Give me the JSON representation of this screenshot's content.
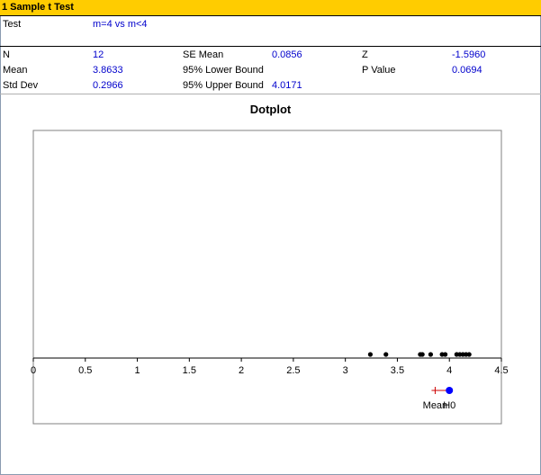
{
  "window": {
    "title": "1 Sample t Test"
  },
  "test": {
    "label": "Test",
    "value": "m=4 vs m<4"
  },
  "stats": {
    "n_label": "N",
    "n_value": "12",
    "mean_label": "Mean",
    "mean_value": "3.8633",
    "sd_label": "Std Dev",
    "sd_value": "0.2966",
    "se_label": "SE Mean",
    "se_value": "0.0856",
    "lower_label": "95% Lower Bound",
    "lower_value": "",
    "upper_label": "95% Upper Bound",
    "upper_value": "4.0171",
    "z_label": "Z",
    "z_value": "-1.5960",
    "p_label": "P Value",
    "p_value": "0.0694"
  },
  "chart_data": {
    "type": "scatter",
    "title": "Dotplot",
    "xlim": [
      0,
      4.5
    ],
    "x_ticks": [
      0,
      0.5,
      1,
      1.5,
      2,
      2.5,
      3,
      3.5,
      4,
      4.5
    ],
    "x_tick_labels": [
      "0",
      "0.5",
      "1",
      "1.5",
      "2",
      "2.5",
      "3",
      "3.5",
      "4",
      "4.5"
    ],
    "points": [
      3.24,
      3.39,
      3.72,
      3.74,
      3.82,
      3.93,
      3.96,
      4.07,
      4.1,
      4.13,
      4.16,
      4.19
    ],
    "mean": 3.8633,
    "h0": 4,
    "mean_label": "Mean",
    "h0_label": "H0",
    "colors": {
      "points": "#000000",
      "mean": "#cc0000",
      "h0": "#0000ff",
      "interval": "#cc0000"
    }
  }
}
